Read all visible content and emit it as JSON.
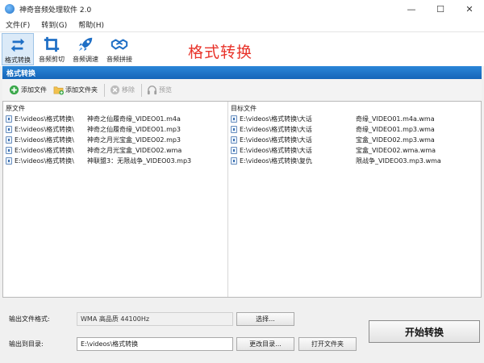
{
  "window": {
    "title": "神奇音频处理软件 2.0",
    "minimize": "—",
    "maximize": "☐",
    "close": "✕"
  },
  "menu": [
    "文件(F)",
    "转到(G)",
    "帮助(H)"
  ],
  "toolbar": {
    "tools": [
      {
        "label": "格式转换",
        "icon": "convert-icon",
        "active": true
      },
      {
        "label": "音频剪切",
        "icon": "crop-icon",
        "active": false
      },
      {
        "label": "音频调速",
        "icon": "rocket-icon",
        "active": false
      },
      {
        "label": "音频拼接",
        "icon": "handshake-icon",
        "active": false
      }
    ],
    "banner": "格式转换"
  },
  "panel": {
    "title": "格式转换"
  },
  "subtoolbar": {
    "add_file": "添加文件",
    "add_folder": "添加文件夹",
    "remove": "移除",
    "preview": "预览"
  },
  "list": {
    "source_header": "原文件",
    "target_header": "目标文件",
    "rows": [
      {
        "source": "E:\\videos\\格式转换\\",
        "source_name": "神奇之仙履奇缘_VIDEO01.m4a",
        "target": "E:\\videos\\格式转换\\大话",
        "target_name": "奇缘_VIDEO01.m4a.wma"
      },
      {
        "source": "E:\\videos\\格式转换\\",
        "source_name": "神奇之仙履奇缘_VIDEO01.mp3",
        "target": "E:\\videos\\格式转换\\大话",
        "target_name": "奇缘_VIDEO01.mp3.wma"
      },
      {
        "source": "E:\\videos\\格式转换\\",
        "source_name": "神奇之月光宝盒_VIDEO02.mp3",
        "target": "E:\\videos\\格式转换\\大话",
        "target_name": "宝盒_VIDEO02.mp3.wma"
      },
      {
        "source": "E:\\videos\\格式转换\\",
        "source_name": "神奇之月光宝盒_VIDEO02.wma",
        "target": "E:\\videos\\格式转换\\大话",
        "target_name": "宝盒_VIDEO02.wma.wma"
      },
      {
        "source": "E:\\videos\\格式转换\\",
        "source_name": "神联盟3：无限战争_VIDEO03.mp3",
        "target": "E:\\videos\\格式转换\\复仇",
        "target_name": "限战争_VIDEO03.mp3.wma"
      }
    ]
  },
  "output": {
    "format_label": "输出文件格式:",
    "format_value": "WMA 高品质 44100Hz",
    "choose_button": "选择...",
    "dir_label": "输出到目录:",
    "dir_value": "E:\\videos\\格式转换",
    "change_dir_button": "更改目录...",
    "open_folder_button": "打开文件夹",
    "start_button": "开始转换"
  },
  "colors": {
    "accent": "#1f6fc5",
    "banner": "#e8332a",
    "header": "#1c74c9"
  }
}
